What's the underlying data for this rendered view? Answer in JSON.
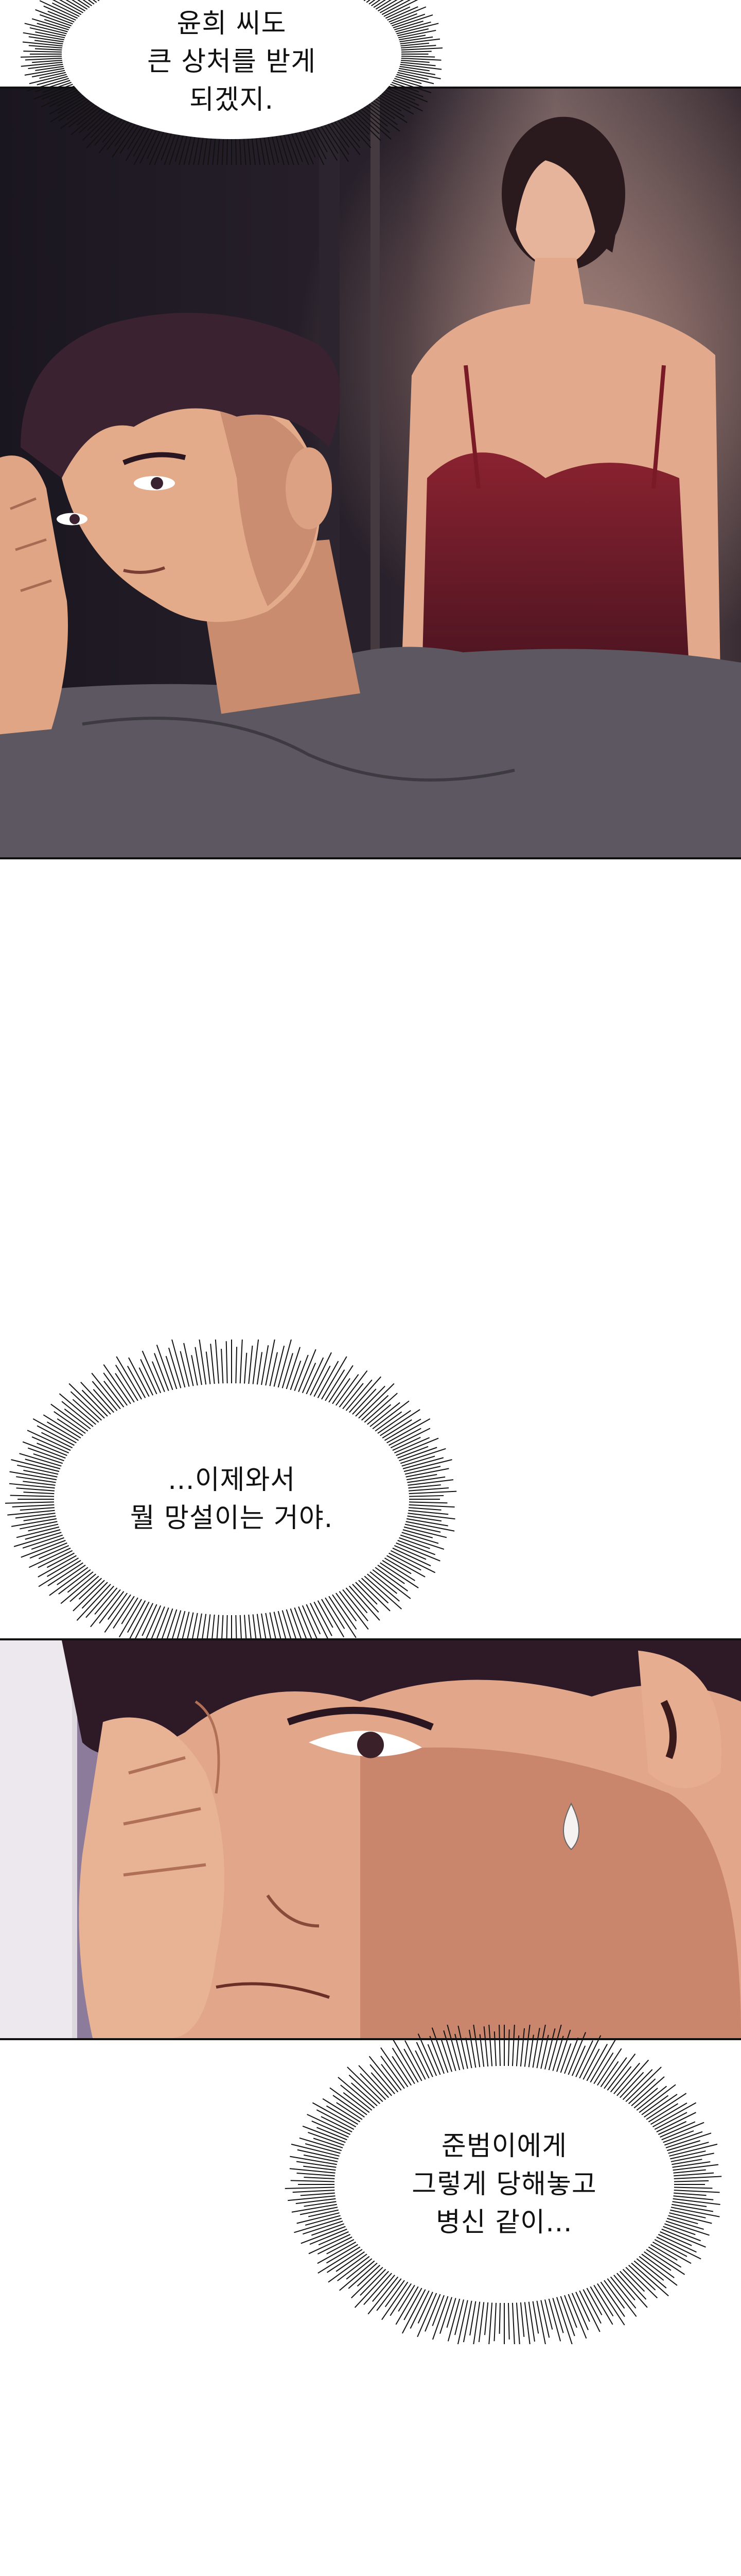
{
  "bubbles": [
    {
      "lines": "윤희 씨도\n큰 상처를 받게\n되겠지."
    },
    {
      "lines": "…이제와서\n뭘 망설이는 거야."
    },
    {
      "lines": "준범이에게\n그렇게 당해놓고\n병신 같이…"
    }
  ],
  "colors": {
    "panel_dark": "#1f1a22",
    "panel_warm": "#6b3a3a",
    "skin": "#e8b08f",
    "hair": "#3a2230",
    "shirt": "#5f5a63",
    "bubble_fill": "#ffffff",
    "ink": "#111111"
  }
}
